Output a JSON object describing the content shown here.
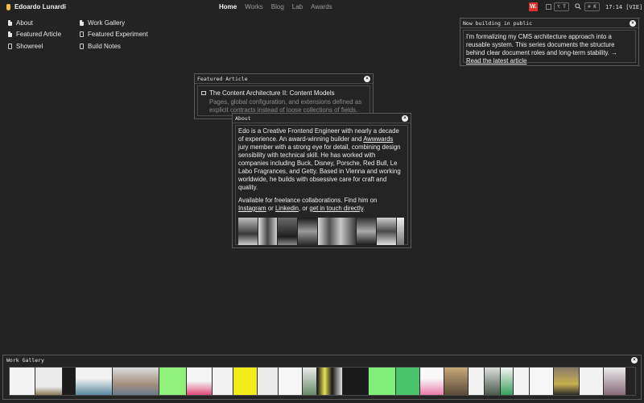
{
  "brand": "Edoardo Lunardi",
  "nav": [
    {
      "label": "Home",
      "active": true
    },
    {
      "label": "Works",
      "active": false
    },
    {
      "label": "Blog",
      "active": false
    },
    {
      "label": "Lab",
      "active": false
    },
    {
      "label": "Awards",
      "active": false
    }
  ],
  "toolbar": {
    "badge": "W.",
    "tag_shortcut": "⌥ T",
    "search_shortcut": "⌘ K",
    "clock": "17:14 [VIE]"
  },
  "desktop_icons": [
    {
      "label": "About"
    },
    {
      "label": "Featured Article"
    },
    {
      "label": "Showreel"
    },
    {
      "label": "Work Gallery"
    },
    {
      "label": "Featured Experiment"
    },
    {
      "label": "Build Notes"
    }
  ],
  "now_building": {
    "title": "Now building in public",
    "text": "I'm formalizing my CMS architecture approach into a reusable system. This series documents the structure behind clear document roles and long-term stability. →",
    "link": "Read the latest article"
  },
  "featured_article": {
    "title": "Featured Article",
    "item_title": "The Content Architecture II: Content Models",
    "item_desc": "Pages, global configuration, and extensions defined as explicit contracts instead of loose collections of fields."
  },
  "about": {
    "title": "About",
    "p1_a": "Edo is a Creative Frontend Engineer with nearly a decade of experience. An award-winning builder and ",
    "p1_link": "Awwwards",
    "p1_b": " jury member with a strong eye for detail, combining design sensibility with technical skill. He has worked with companies including Buck, Disney, Porsche, Red Bull, Le Labo Fragrances, and Getty. Based in Vienna and working worldwide, he builds with obsessive care for craft and quality.",
    "p2_a": "Available for freelance collaborations. Find him on ",
    "link_instagram": "Instagram",
    "p2_or1": " or ",
    "link_linkedin": "Linkedin",
    "p2_or2": ", or ",
    "link_contact": "get in touch directly",
    "p2_end": "."
  },
  "work_gallery": {
    "title": "Work Gallery"
  },
  "colors": {
    "background": "#232323",
    "badge": "#e0302a",
    "accent_yellow": "#f0c040"
  }
}
